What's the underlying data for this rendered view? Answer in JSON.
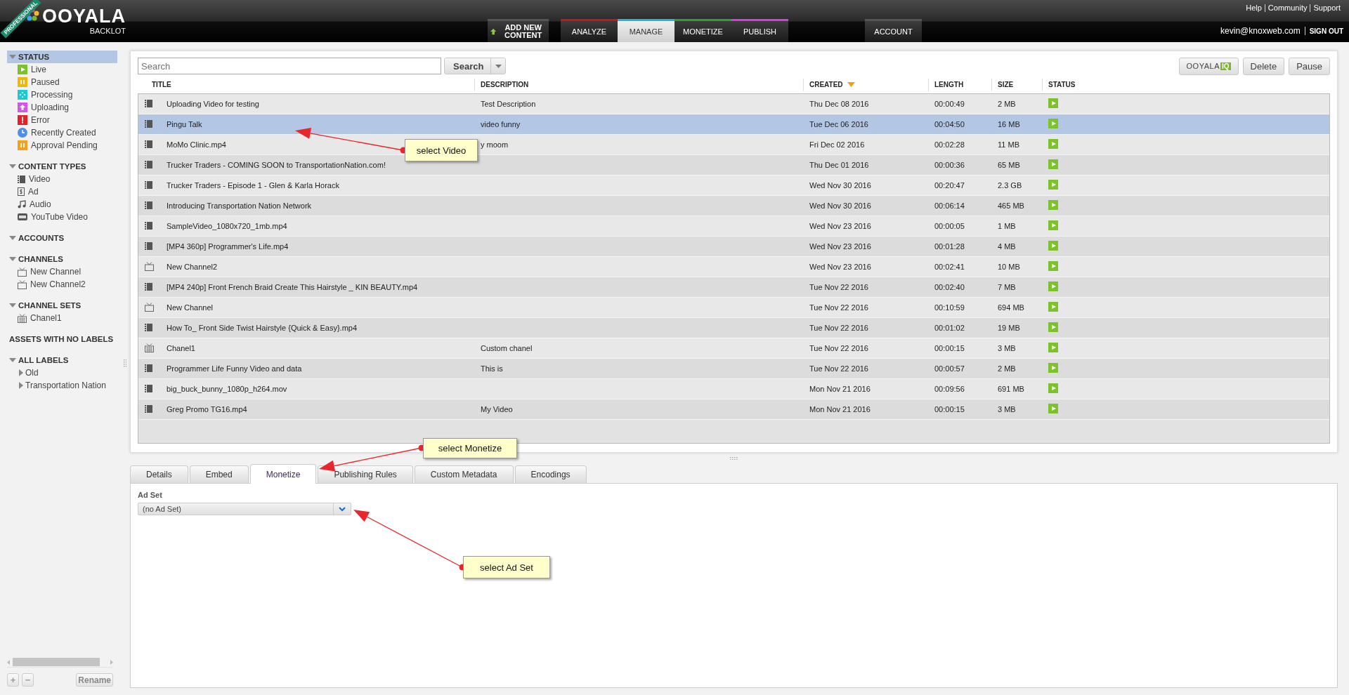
{
  "header": {
    "badge": "PROFESSIONAL",
    "logo": "OOYALA",
    "product": "BACKLOT",
    "top_links": [
      "Help",
      "Community",
      "Support"
    ],
    "user": "kevin@knoxweb.com",
    "sign_out": "SIGN OUT"
  },
  "nav": [
    {
      "label": "ADD NEW CONTENT",
      "kind": "add",
      "selected": false
    },
    {
      "label": "ANALYZE",
      "kind": "tab",
      "color": "#c4161c",
      "selected": false
    },
    {
      "label": "MANAGE",
      "kind": "tab",
      "color": "#1cb8d8",
      "selected": true
    },
    {
      "label": "MONETIZE",
      "kind": "tab",
      "color": "#2f9e3a",
      "selected": false
    },
    {
      "label": "PUBLISH",
      "kind": "tab",
      "color": "#d93ae0",
      "selected": false
    },
    {
      "label": "ACCOUNT",
      "kind": "account",
      "selected": false
    }
  ],
  "sidebar": {
    "sections": [
      {
        "title": "STATUS",
        "expanded": true,
        "selected": true,
        "items": [
          {
            "label": "Live",
            "kind": "live"
          },
          {
            "label": "Paused",
            "kind": "paused"
          },
          {
            "label": "Processing",
            "kind": "processing"
          },
          {
            "label": "Uploading",
            "kind": "uploading"
          },
          {
            "label": "Error",
            "kind": "error"
          },
          {
            "label": "Recently Created",
            "kind": "recent"
          },
          {
            "label": "Approval Pending",
            "kind": "approval"
          }
        ]
      },
      {
        "title": "CONTENT TYPES",
        "expanded": true,
        "selected": false,
        "items": [
          {
            "label": "Video",
            "kind": "video"
          },
          {
            "label": "Ad",
            "kind": "ad"
          },
          {
            "label": "Audio",
            "kind": "audio"
          },
          {
            "label": "YouTube Video",
            "kind": "youtube"
          }
        ]
      },
      {
        "title": "ACCOUNTS",
        "expanded": true,
        "selected": false
      },
      {
        "title": "CHANNELS",
        "expanded": true,
        "selected": false,
        "items": [
          {
            "label": "New Channel",
            "kind": "channel"
          },
          {
            "label": "New Channel2",
            "kind": "channel"
          }
        ]
      },
      {
        "title": "CHANNEL SETS",
        "expanded": true,
        "selected": false,
        "items": [
          {
            "label": "Chanel1",
            "kind": "channel-set"
          }
        ]
      },
      {
        "title": "ASSETS WITH NO LABELS",
        "selected": false
      },
      {
        "title": "ALL LABELS",
        "expanded": true,
        "selected": false,
        "items": [
          {
            "label": "Old",
            "kind": "label",
            "expanded": false
          },
          {
            "label": "Transportation Nation",
            "kind": "label",
            "expanded": false
          }
        ]
      }
    ],
    "buttons": [
      "+",
      "−"
    ],
    "rename": "Rename"
  },
  "toolbar": {
    "search_placeholder": "Search",
    "search_button": "Search",
    "iq_logo": "OOYALA",
    "iq_badge": "IQ",
    "buttons": [
      "Delete",
      "Pause"
    ]
  },
  "table": {
    "columns": [
      {
        "label": "TITLE",
        "sorted": false
      },
      {
        "label": "DESCRIPTION",
        "sorted": false
      },
      {
        "label": "CREATED",
        "sorted": true
      },
      {
        "label": "LENGTH",
        "sorted": false
      },
      {
        "label": "SIZE",
        "sorted": false
      },
      {
        "label": "STATUS",
        "sorted": false
      }
    ],
    "rows": [
      {
        "kind": "video",
        "title": "Uploading Video for testing",
        "description": "Test Description",
        "created": "Thu Dec 08 2016",
        "length": "00:00:49",
        "size": "2 MB",
        "live": true,
        "selected": false
      },
      {
        "kind": "video",
        "title": "Pingu Talk",
        "description": "video funny",
        "created": "Tue Dec 06 2016",
        "length": "00:04:50",
        "size": "16 MB",
        "live": true,
        "selected": true
      },
      {
        "kind": "video",
        "title": "MoMo Clinic.mp4",
        "description": "y moom",
        "created": "Fri Dec 02 2016",
        "length": "00:02:28",
        "size": "11 MB",
        "live": true,
        "selected": false
      },
      {
        "kind": "video",
        "title": "Trucker Traders - COMING SOON to TransportationNation.com!",
        "created": "Thu Dec 01 2016",
        "length": "00:00:36",
        "size": "65 MB",
        "live": true,
        "selected": false
      },
      {
        "kind": "video",
        "title": "Trucker Traders - Episode 1 - Glen & Karla Horack",
        "created": "Wed Nov 30 2016",
        "length": "00:20:47",
        "size": "2.3 GB",
        "live": true,
        "selected": false
      },
      {
        "kind": "video",
        "title": "Introducing Transportation Nation Network",
        "created": "Wed Nov 30 2016",
        "length": "00:06:14",
        "size": "465 MB",
        "live": true,
        "selected": false
      },
      {
        "kind": "video",
        "title": "SampleVideo_1080x720_1mb.mp4",
        "created": "Wed Nov 23 2016",
        "length": "00:00:05",
        "size": "1 MB",
        "live": true,
        "selected": false
      },
      {
        "kind": "video",
        "title": "[MP4 360p] Programmer's Life.mp4",
        "created": "Wed Nov 23 2016",
        "length": "00:01:28",
        "size": "4 MB",
        "live": true,
        "selected": false
      },
      {
        "kind": "channel",
        "title": "New Channel2",
        "created": "Wed Nov 23 2016",
        "length": "00:02:41",
        "size": "10 MB",
        "live": true,
        "selected": false
      },
      {
        "kind": "video",
        "title": "[MP4 240p] Front French Braid Create This Hairstyle _ KIN BEAUTY.mp4",
        "created": "Tue Nov 22 2016",
        "length": "00:02:40",
        "size": "7 MB",
        "live": true,
        "selected": false
      },
      {
        "kind": "channel",
        "title": "New Channel",
        "created": "Tue Nov 22 2016",
        "length": "00:10:59",
        "size": "694 MB",
        "live": true,
        "selected": false
      },
      {
        "kind": "video",
        "title": "How To_ Front Side Twist Hairstyle {Quick & Easy}.mp4",
        "created": "Tue Nov 22 2016",
        "length": "00:01:02",
        "size": "19 MB",
        "live": true,
        "selected": false
      },
      {
        "kind": "channel-set",
        "title": "Chanel1",
        "description": "Custom chanel",
        "created": "Tue Nov 22 2016",
        "length": "00:00:15",
        "size": "3 MB",
        "live": true,
        "selected": false
      },
      {
        "kind": "video",
        "title": "Programmer Life Funny Video and data",
        "description": "This is",
        "created": "Tue Nov 22 2016",
        "length": "00:00:57",
        "size": "2 MB",
        "live": true,
        "selected": false
      },
      {
        "kind": "video",
        "title": "big_buck_bunny_1080p_h264.mov",
        "created": "Mon Nov 21 2016",
        "length": "00:09:56",
        "size": "691 MB",
        "live": true,
        "selected": false
      },
      {
        "kind": "video",
        "title": "Greg Promo TG16.mp4",
        "description": "My Video",
        "created": "Mon Nov 21 2016",
        "length": "00:00:15",
        "size": "3 MB",
        "live": true,
        "selected": false
      }
    ]
  },
  "detail_tabs": [
    {
      "label": "Details",
      "selected": false
    },
    {
      "label": "Embed",
      "selected": false
    },
    {
      "label": "Monetize",
      "selected": true
    },
    {
      "label": "Publishing Rules",
      "selected": false
    },
    {
      "label": "Custom Metadata",
      "selected": false
    },
    {
      "label": "Encodings",
      "selected": false
    }
  ],
  "ad_set": {
    "label": "Ad Set",
    "value": "(no Ad Set)"
  },
  "annotations": [
    {
      "text": "select Video"
    },
    {
      "text": "select Monetize"
    },
    {
      "text": "select Ad Set"
    }
  ]
}
